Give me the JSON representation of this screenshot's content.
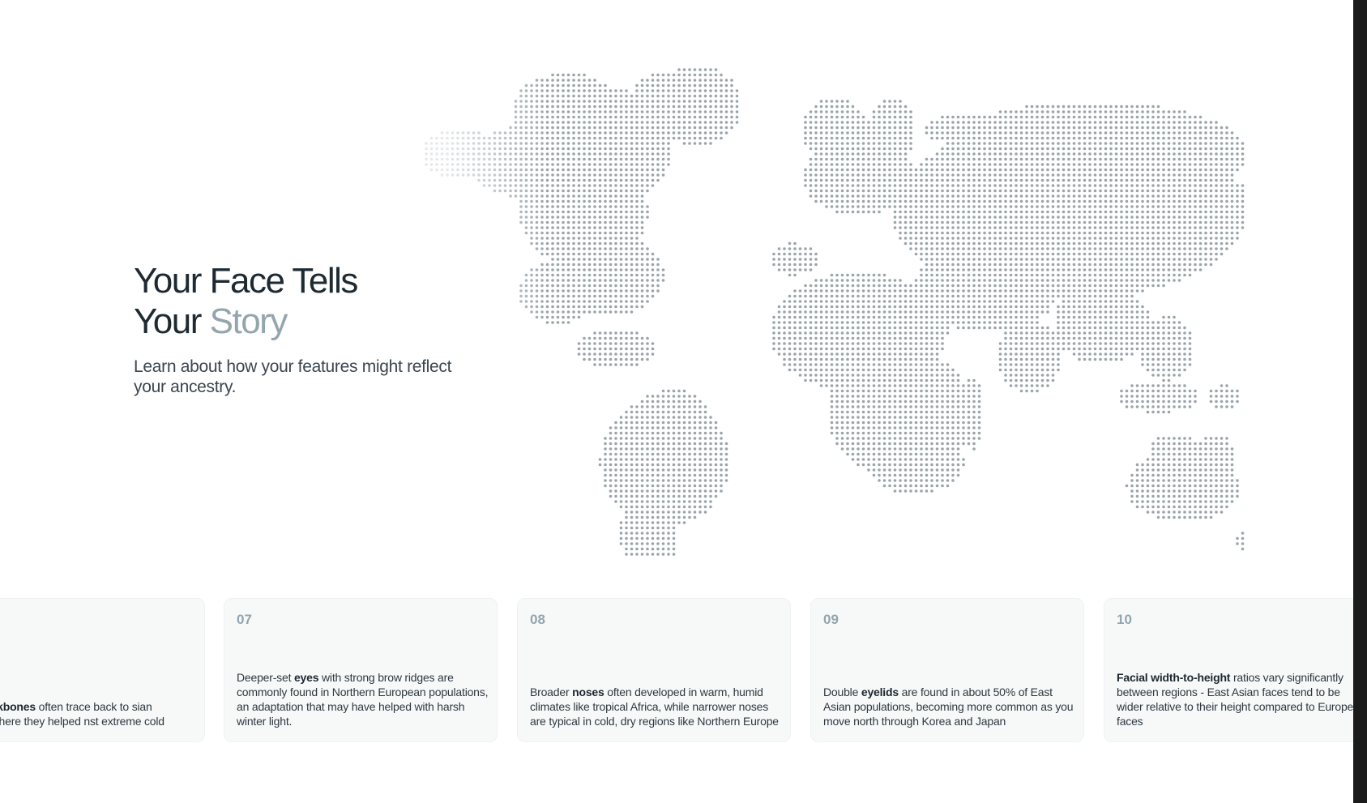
{
  "hero": {
    "title_line1": "Your Face Tells",
    "title_word": "Your ",
    "title_accent": "Story",
    "subtitle": "Learn about how your features might reflect your ancestry."
  },
  "colors": {
    "title": "#1e2a32",
    "accent": "#93a5ad",
    "map_dot": "#9aa5aa",
    "card_bg": "#f7f9f9"
  },
  "cards": [
    {
      "num": "",
      "pre": "ment ",
      "bold": "cheekbones",
      "post": " often trace back to sian ancestry, where they helped nst extreme cold"
    },
    {
      "num": "07",
      "pre": "Deeper-set ",
      "bold": "eyes",
      "post": " with strong brow ridges are commonly found in Northern European populations, an adaptation that may have helped with harsh winter light."
    },
    {
      "num": "08",
      "pre": "Broader ",
      "bold": "noses",
      "post": " often developed in warm, humid climates like tropical Africa, while narrower noses are typical in cold, dry regions like Northern Europe"
    },
    {
      "num": "09",
      "pre": "Double ",
      "bold": "eyelids",
      "post": " are found in about 50% of East Asian populations, becoming more common as you move north through Korea and Japan"
    },
    {
      "num": "10",
      "pre": "",
      "bold": "Facial width-to-height",
      "post": " ratios vary significantly between regions - East Asian faces tend to be wider relative to their height compared to European faces"
    }
  ]
}
